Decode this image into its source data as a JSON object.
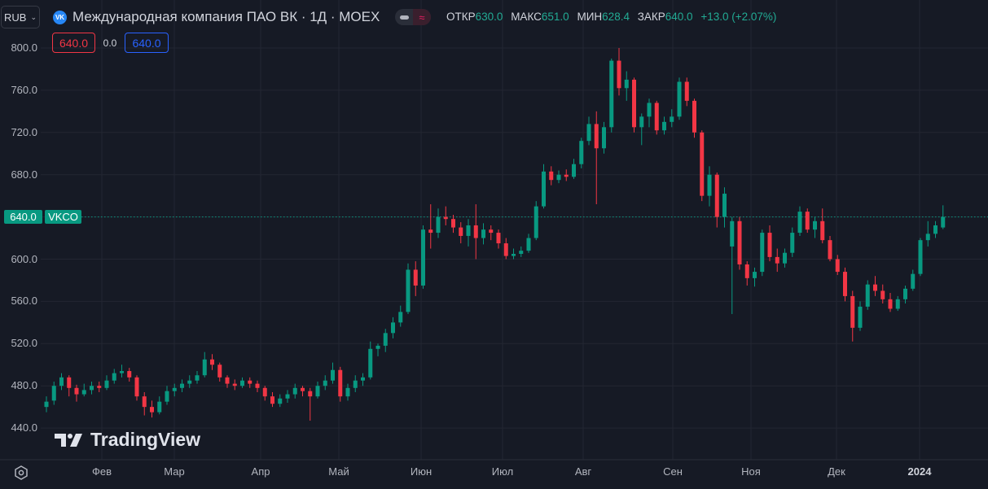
{
  "header": {
    "currency": "RUB",
    "logo_text": "VK",
    "title": "Международная компания ПАО ВК · 1Д · MOEX",
    "ohlc": {
      "open_label": "ОТКР",
      "open": "630.0",
      "high_label": "МАКС",
      "high": "651.0",
      "low_label": "МИН",
      "low": "628.4",
      "close_label": "ЗАКР",
      "close": "640.0",
      "change": "+13.0 (+2.07%)"
    },
    "sell_price": "640.0",
    "spread": "0.0",
    "buy_price": "640.0"
  },
  "price_label": {
    "value": "640.0",
    "ticker": "VKCO"
  },
  "watermark": "TradingView",
  "colors": {
    "up": "#089981",
    "down": "#f23645",
    "background": "#161a25",
    "grid": "#232632",
    "price_line": "#089981"
  },
  "chart_data": {
    "type": "candlestick",
    "title": "Международная компания ПАО ВК · 1Д · MOEX",
    "ylim": [
      440,
      800
    ],
    "y_ticks": [
      "800.0",
      "760.0",
      "720.0",
      "680.0",
      "640.0",
      "600.0",
      "560.0",
      "520.0",
      "480.0",
      "440.0"
    ],
    "y_tick_values": [
      800,
      760,
      720,
      680,
      640,
      600,
      560,
      520,
      480,
      440
    ],
    "x_ticks": [
      "Фев",
      "Мар",
      "Апр",
      "Май",
      "Июн",
      "Июл",
      "Авг",
      "Сен",
      "Ноя",
      "Дек",
      "2024"
    ],
    "grid": true,
    "last_price": 640.0,
    "ohlc": [
      [
        460,
        470,
        455,
        465
      ],
      [
        466,
        484,
        462,
        480
      ],
      [
        480,
        492,
        476,
        488
      ],
      [
        488,
        490,
        470,
        478
      ],
      [
        478,
        481,
        465,
        472
      ],
      [
        472,
        482,
        470,
        476
      ],
      [
        476,
        484,
        472,
        480
      ],
      [
        480,
        484,
        474,
        478
      ],
      [
        478,
        490,
        476,
        485
      ],
      [
        485,
        496,
        482,
        492
      ],
      [
        492,
        500,
        488,
        494
      ],
      [
        494,
        497,
        484,
        488
      ],
      [
        488,
        490,
        466,
        470
      ],
      [
        470,
        474,
        452,
        460
      ],
      [
        460,
        466,
        450,
        455
      ],
      [
        455,
        470,
        453,
        465
      ],
      [
        465,
        480,
        462,
        475
      ],
      [
        475,
        482,
        470,
        478
      ],
      [
        478,
        486,
        474,
        482
      ],
      [
        482,
        490,
        478,
        485
      ],
      [
        485,
        494,
        482,
        490
      ],
      [
        490,
        512,
        488,
        505
      ],
      [
        505,
        510,
        495,
        500
      ],
      [
        500,
        502,
        484,
        488
      ],
      [
        488,
        490,
        478,
        482
      ],
      [
        482,
        486,
        476,
        480
      ],
      [
        480,
        488,
        478,
        485
      ],
      [
        485,
        488,
        478,
        482
      ],
      [
        482,
        485,
        474,
        478
      ],
      [
        478,
        480,
        466,
        470
      ],
      [
        470,
        474,
        460,
        463
      ],
      [
        463,
        472,
        460,
        468
      ],
      [
        468,
        476,
        464,
        472
      ],
      [
        472,
        482,
        468,
        478
      ],
      [
        478,
        480,
        470,
        475
      ],
      [
        475,
        478,
        447,
        470
      ],
      [
        470,
        484,
        468,
        480
      ],
      [
        480,
        490,
        476,
        485
      ],
      [
        485,
        502,
        482,
        495
      ],
      [
        495,
        498,
        465,
        470
      ],
      [
        470,
        482,
        466,
        478
      ],
      [
        478,
        490,
        474,
        485
      ],
      [
        485,
        492,
        480,
        488
      ],
      [
        488,
        522,
        486,
        515
      ],
      [
        515,
        520,
        508,
        518
      ],
      [
        518,
        534,
        512,
        530
      ],
      [
        530,
        545,
        525,
        540
      ],
      [
        540,
        556,
        536,
        550
      ],
      [
        550,
        596,
        548,
        590
      ],
      [
        590,
        598,
        565,
        575
      ],
      [
        575,
        632,
        572,
        628
      ],
      [
        628,
        652,
        610,
        625
      ],
      [
        625,
        648,
        620,
        640
      ],
      [
        640,
        650,
        632,
        638
      ],
      [
        638,
        642,
        625,
        630
      ],
      [
        630,
        635,
        615,
        622
      ],
      [
        622,
        638,
        612,
        632
      ],
      [
        632,
        652,
        600,
        620
      ],
      [
        620,
        634,
        614,
        628
      ],
      [
        628,
        632,
        618,
        625
      ],
      [
        625,
        628,
        610,
        615
      ],
      [
        615,
        620,
        600,
        603
      ],
      [
        603,
        610,
        600,
        605
      ],
      [
        605,
        612,
        602,
        608
      ],
      [
        608,
        624,
        606,
        620
      ],
      [
        620,
        655,
        618,
        650
      ],
      [
        650,
        690,
        648,
        683
      ],
      [
        683,
        688,
        670,
        675
      ],
      [
        675,
        684,
        672,
        680
      ],
      [
        680,
        685,
        674,
        678
      ],
      [
        678,
        695,
        676,
        690
      ],
      [
        690,
        715,
        686,
        712
      ],
      [
        712,
        735,
        708,
        728
      ],
      [
        728,
        740,
        652,
        705
      ],
      [
        705,
        730,
        700,
        725
      ],
      [
        725,
        790,
        720,
        788
      ],
      [
        788,
        800,
        755,
        762
      ],
      [
        762,
        778,
        750,
        770
      ],
      [
        770,
        772,
        720,
        725
      ],
      [
        725,
        738,
        708,
        735
      ],
      [
        735,
        752,
        725,
        748
      ],
      [
        748,
        750,
        718,
        722
      ],
      [
        722,
        735,
        718,
        730
      ],
      [
        730,
        742,
        725,
        735
      ],
      [
        735,
        772,
        732,
        768
      ],
      [
        768,
        772,
        745,
        750
      ],
      [
        750,
        752,
        715,
        720
      ],
      [
        720,
        722,
        655,
        660
      ],
      [
        660,
        688,
        650,
        680
      ],
      [
        680,
        682,
        630,
        640
      ],
      [
        640,
        668,
        630,
        662
      ],
      [
        612,
        640,
        548,
        636
      ],
      [
        636,
        640,
        590,
        595
      ],
      [
        595,
        598,
        575,
        582
      ],
      [
        582,
        592,
        574,
        588
      ],
      [
        588,
        628,
        584,
        625
      ],
      [
        625,
        632,
        598,
        602
      ],
      [
        602,
        610,
        588,
        596
      ],
      [
        596,
        610,
        592,
        606
      ],
      [
        606,
        630,
        602,
        625
      ],
      [
        625,
        650,
        622,
        645
      ],
      [
        645,
        648,
        625,
        628
      ],
      [
        628,
        640,
        620,
        636
      ],
      [
        636,
        648,
        615,
        618
      ],
      [
        618,
        622,
        598,
        600
      ],
      [
        600,
        604,
        585,
        588
      ],
      [
        588,
        592,
        560,
        565
      ],
      [
        565,
        570,
        522,
        535
      ],
      [
        535,
        560,
        532,
        555
      ],
      [
        555,
        580,
        552,
        576
      ],
      [
        576,
        584,
        565,
        570
      ],
      [
        570,
        576,
        558,
        562
      ],
      [
        562,
        568,
        550,
        553
      ],
      [
        553,
        565,
        551,
        562
      ],
      [
        562,
        575,
        558,
        572
      ],
      [
        572,
        590,
        570,
        586
      ],
      [
        586,
        620,
        584,
        618
      ],
      [
        618,
        636,
        612,
        624
      ],
      [
        624,
        636,
        620,
        632
      ],
      [
        630,
        651,
        628.4,
        640
      ]
    ]
  }
}
